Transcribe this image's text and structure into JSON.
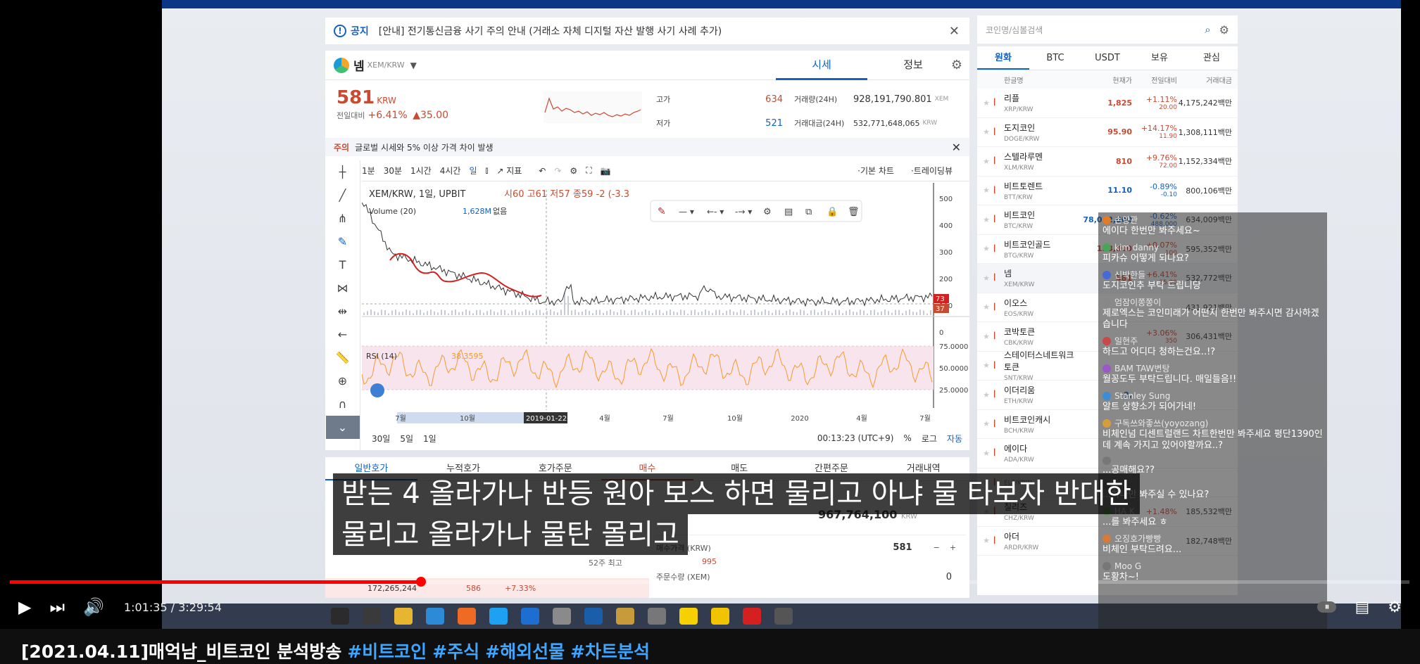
{
  "notice": {
    "label": "공지",
    "text": "[안내] 전기통신금융 사기 주의 안내 (거래소 자체 디지털 자산 발행 사기 사례 추가)"
  },
  "coin": {
    "name": "넴",
    "pair": "XEM/KRW",
    "tabs": [
      "시세",
      "정보"
    ],
    "price": "581",
    "unit": "KRW",
    "change_label": "전일대비",
    "change_pct": "+6.41%",
    "change_abs": "▲35.00",
    "high_label": "고가",
    "high": "634",
    "low_label": "저가",
    "low": "521",
    "vol_label": "거래량(24H)",
    "vol": "928,191,790.801",
    "vol_unit": "XEM",
    "amt_label": "거래대금(24H)",
    "amt": "532,771,648,065",
    "amt_unit": "KRW"
  },
  "warning": {
    "label": "주의",
    "text": "글로벌 시세와 5% 이상 가격 차이 발생"
  },
  "toolbar": {
    "intervals": [
      "1분",
      "30분",
      "1시간",
      "4시간",
      "일"
    ],
    "indicator": "지표",
    "basic_chart": "기본 차트",
    "tradingview": "트레이딩뷰"
  },
  "chart": {
    "symbol_label": "XEM/KRW, 1일, UPBIT",
    "ohlc": "시60 고61 저57 종59 -2 (-3.3",
    "volume_label": "Volume (20)",
    "volume_val": "1,628M",
    "volume_none": "없음",
    "rsi_label": "RSI (14)",
    "rsi_val": "38.3595",
    "price_ticks": [
      "500",
      "400",
      "300",
      "200",
      "100",
      "0"
    ],
    "rsi_ticks": [
      "75.0000",
      "50.0000",
      "25.0000"
    ],
    "x_ticks": [
      "7월",
      "10월",
      "2019-01-22",
      "4월",
      "7월",
      "10월",
      "2020",
      "4월",
      "7월"
    ],
    "price_badges": [
      "73",
      "37"
    ],
    "ranges": [
      "30일",
      "5일",
      "1일"
    ],
    "clock": "00:13:23 (UTC+9)",
    "pct": "%",
    "log": "로그",
    "auto": "자동"
  },
  "orders": {
    "tabs": [
      "일반호가",
      "누적호가",
      "호가주문",
      "매수",
      "매도",
      "간편주문",
      "거래내역"
    ]
  },
  "search": {
    "placeholder": "코인명/심볼검색"
  },
  "market": {
    "tabs": [
      "원화",
      "BTC",
      "USDT",
      "보유",
      "관심"
    ],
    "headers": [
      "한글명",
      "현재가",
      "전일대비",
      "거래대금"
    ],
    "rows": [
      {
        "name": "리플",
        "sym": "XRP/KRW",
        "price": "1,825",
        "pct": "+1.11%",
        "abs": "20.00",
        "vol": "4,175,242백만",
        "dir": "up"
      },
      {
        "name": "도지코인",
        "sym": "DOGE/KRW",
        "price": "95.90",
        "pct": "+14.17%",
        "abs": "11.90",
        "vol": "1,308,111백만",
        "dir": "up"
      },
      {
        "name": "스텔라루멘",
        "sym": "XLM/KRW",
        "price": "810",
        "pct": "+9.76%",
        "abs": "72.00",
        "vol": "1,152,334백만",
        "dir": "up"
      },
      {
        "name": "비트토렌트",
        "sym": "BTT/KRW",
        "price": "11.10",
        "pct": "-0.89%",
        "abs": "-0.10",
        "vol": "800,106백만",
        "dir": "dn"
      },
      {
        "name": "비트코인",
        "sym": "BTC/KRW",
        "price": "78,042,000",
        "pct": "-0.62%",
        "abs": "488,000",
        "vol": "634,009백만",
        "dir": "dn"
      },
      {
        "name": "비트코인골드",
        "sym": "BTG/KRW",
        "price": "153,000",
        "pct": "+0.07%",
        "abs": "100",
        "vol": "595,352백만",
        "dir": "up"
      },
      {
        "name": "넴",
        "sym": "XEM/KRW",
        "price": "581",
        "pct": "+6.41%",
        "abs": "35.00",
        "vol": "532,772백만",
        "dir": "up"
      },
      {
        "name": "이오스",
        "sym": "EOS/KRW",
        "price": "",
        "pct": "",
        "abs": "",
        "vol": "431,921백만",
        "dir": "up"
      },
      {
        "name": "코박토큰",
        "sym": "CBK/KRW",
        "price": "",
        "pct": "+3.06%",
        "abs": "350",
        "vol": "306,431백만",
        "dir": "up"
      },
      {
        "name": "스테이터스네트워크토큰",
        "sym": "SNT/KRW",
        "price": "",
        "pct": "",
        "abs": "",
        "vol": "",
        "dir": "up"
      },
      {
        "name": "이더리움",
        "sym": "ETH/KRW",
        "price": "2,",
        "pct": "",
        "abs": "",
        "vol": "",
        "dir": "dn"
      },
      {
        "name": "비트코인캐시",
        "sym": "BCH/KRW",
        "price": "",
        "pct": "",
        "abs": "",
        "vol": "",
        "dir": "up"
      },
      {
        "name": "에이다",
        "sym": "ADA/KRW",
        "price": "",
        "pct": "",
        "abs": "",
        "vol": "",
        "dir": "up"
      },
      {
        "name": "",
        "sym": "ELF/KRW",
        "price": "",
        "pct": "",
        "abs": "",
        "vol": "",
        "dir": "up"
      },
      {
        "name": "칠리즈",
        "sym": "CHZ/KRW",
        "price": "",
        "pct": "+1.48%",
        "abs": "",
        "vol": "185,532백만",
        "dir": "up"
      },
      {
        "name": "아더",
        "sym": "ARDR/KRW",
        "price": "",
        "pct": "",
        "abs": "",
        "vol": "182,748백만",
        "dir": "dn"
      }
    ]
  },
  "order_form": {
    "total": "967,764,100",
    "total_unit": "KRW",
    "price_label": "매수가격 (KRW)",
    "price": "581",
    "qty_label": "주문수량 (XEM)",
    "qty": "0",
    "high52": "52주 최고",
    "high52v": "995",
    "ob_price": "586",
    "ob_pct": "+7.33%",
    "ob_vol": "172,265,244"
  },
  "chat": [
    {
      "author": "손양관",
      "text": "에이다 한번만 봐주세요~",
      "color": "#e27b25"
    },
    {
      "author": "kim danny",
      "text": "피카슈 어떻게 되나요?",
      "color": "#49a35a"
    },
    {
      "author": "신박한들",
      "text": "도지코인추 부탁 드립니당",
      "color": "#4669d6"
    },
    {
      "author": "엄잠이쫑쫑이",
      "text": "제로엑스는 코인미래가 어떤지 한번만 봐주시면 감사하겠습니다",
      "color": "#888"
    },
    {
      "author": "일현주",
      "text": "하드고 어디다 청하는건요..!?",
      "color": "#c94848"
    },
    {
      "author": "BAM TAW변탕",
      "text": "월꽁도두 부탁드립니다. 매일들음!!",
      "color": "#9a58c9"
    },
    {
      "author": "Stanley Sung",
      "text": "알트 상향소가 되어가네!",
      "color": "#3b8ed6"
    },
    {
      "author": "구독쓰와좋쓰(yoyozang)",
      "text": "비체인넘 디센트럴랜드 차트한번만 봐주세요 평단1390인데 계속 가지고 있어야할까요..?",
      "color": "#d69e3b"
    },
    {
      "author": "",
      "text": "...공매해요??",
      "color": "#777"
    },
    {
      "author": "",
      "text": "...하나만 봐주실 수 있나요?",
      "color": "#777"
    },
    {
      "author": "HA K",
      "text": "...를 봐주세요 ㅎ",
      "color": "#5a9c52"
    },
    {
      "author": "오징호가빵빵",
      "text": "비체인 부탁드려요...",
      "color": "#d67a3b"
    },
    {
      "author": "Moo G",
      "text": "도황차~!",
      "color": "#777"
    }
  ],
  "caption": {
    "line1": "받는 4 올라가나 반등 원아 보스 하면 물리고 아냐 물 타보자 반대한",
    "line2": "물리고 올라가나 물탄 몰리고"
  },
  "player": {
    "time": "1:01:35 / 3:29:54",
    "progress": 0.294
  },
  "video_title": {
    "main": "[2021.04.11]매억남_비트코인 분석방송",
    "tags": [
      "#비트코인",
      "#주식",
      "#해외선물",
      "#차트분석"
    ]
  },
  "colors": {
    "accent": "#1261c4",
    "up": "#c84a31",
    "down": "#1261c4",
    "yt_red": "#ff0000"
  }
}
